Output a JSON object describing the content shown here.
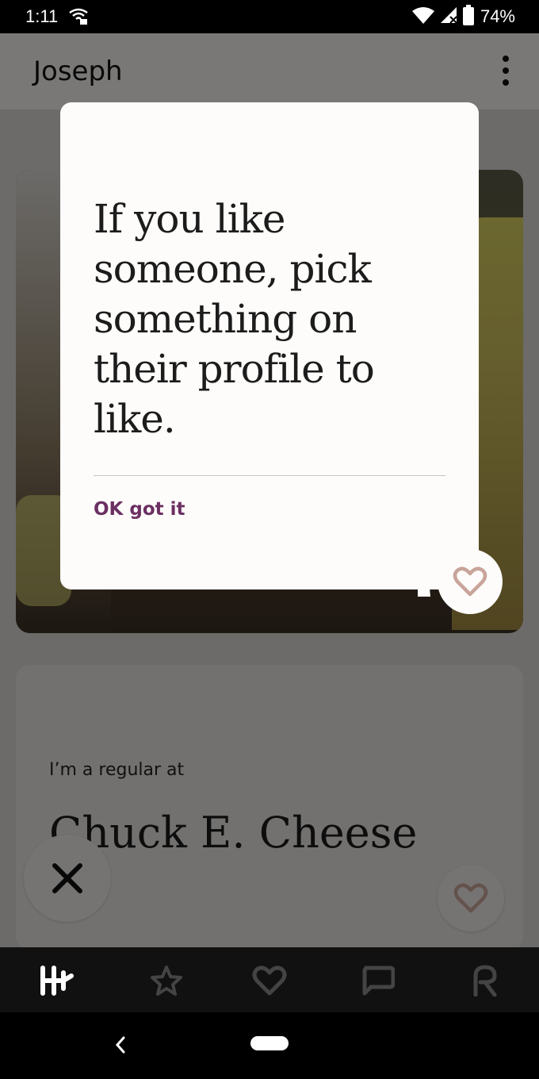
{
  "status_bar": {
    "time": "1:11",
    "battery_percent": "74%",
    "icons": [
      "wifi-lock-icon",
      "wifi-icon",
      "signal-icon",
      "battery-icon"
    ]
  },
  "app_bar": {
    "title": "Joseph",
    "menu_icon": "more-vert-icon"
  },
  "tooltip": {
    "message": "If you like someone, pick something on their profile to like.",
    "action_label": "OK got it"
  },
  "prompt": {
    "label": "I’m a regular at",
    "answer": "Chuck E. Cheese"
  },
  "tab_bar": {
    "tabs": [
      "home-logo-icon",
      "star-icon",
      "heart-icon",
      "chat-icon",
      "profile-icon"
    ]
  },
  "colors": {
    "accent": "#6b2f62",
    "like_icon": "#c9a49a",
    "tab_active": "#ffffff",
    "tab_inactive": "#444444"
  }
}
